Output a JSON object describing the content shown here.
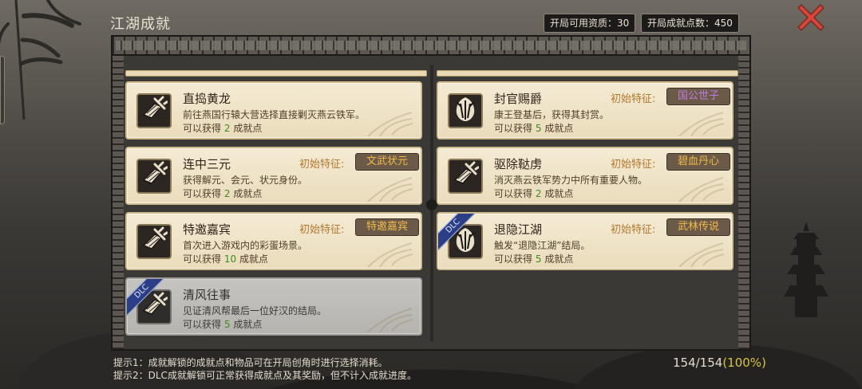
{
  "header": {
    "title": "江湖成就",
    "available_points_label": "开局可用资质：",
    "available_points_value": "30",
    "total_points_label": "开局成就点数：",
    "total_points_value": "450"
  },
  "achievements": [
    {
      "title": "直捣黄龙",
      "description": "前往燕国行辕大营选择直接剿灭燕云铁军。",
      "reward_prefix": "可以获得",
      "points": "2",
      "reward_suffix": "成就点",
      "trait_label": "",
      "trait": "",
      "trait_color": "",
      "dlc": false,
      "icon": "scroll-sword-icon"
    },
    {
      "title": "封官赐爵",
      "description": "康王登基后，获得其封赏。",
      "reward_prefix": "可以获得",
      "points": "5",
      "reward_suffix": "成就点",
      "trait_label": "初始特征:",
      "trait": "国公世子",
      "trait_color": "#c07be0",
      "dlc": false,
      "icon": "crest-icon"
    },
    {
      "title": "连中三元",
      "description": "获得解元、会元、状元身份。",
      "reward_prefix": "可以获得",
      "points": "2",
      "reward_suffix": "成就点",
      "trait_label": "初始特征:",
      "trait": "文武状元",
      "trait_color": "#f0b94b",
      "dlc": false,
      "icon": "scroll-sword-icon"
    },
    {
      "title": "驱除鞑虏",
      "description": "消灭燕云铁军势力中所有重要人物。",
      "reward_prefix": "可以获得",
      "points": "2",
      "reward_suffix": "成就点",
      "trait_label": "初始特征:",
      "trait": "碧血丹心",
      "trait_color": "#f0b94b",
      "dlc": false,
      "icon": "scroll-sword-icon"
    },
    {
      "title": "特邀嘉宾",
      "description": "首次进入游戏内的彩蛋场景。",
      "reward_prefix": "可以获得",
      "points": "10",
      "reward_suffix": "成就点",
      "trait_label": "初始特征:",
      "trait": "特邀嘉宾",
      "trait_color": "#f0b94b",
      "dlc": false,
      "icon": "scroll-sword-icon"
    },
    {
      "title": "退隐江湖",
      "description": "触发“退隐江湖”结局。",
      "reward_prefix": "可以获得",
      "points": "5",
      "reward_suffix": "成就点",
      "trait_label": "初始特征:",
      "trait": "武林传说",
      "trait_color": "#f0b94b",
      "dlc": true,
      "dlc_label": "DLC",
      "icon": "crest-icon"
    },
    {
      "title": "清风往事",
      "description": "见证清风帮最后一位好汉的结局。",
      "reward_prefix": "可以获得",
      "points": "5",
      "reward_suffix": "成就点",
      "trait_label": "",
      "trait": "",
      "trait_color": "",
      "dlc": true,
      "dlc_label": "DLC",
      "icon": "scroll-sword-icon"
    }
  ],
  "hints": [
    "提示1：成就解锁的成就点和物品可在开局创角时进行选择消耗。",
    "提示2：DLC成就解锁可正常获得成就点及其奖励，但不计入成就进度。"
  ],
  "progress": {
    "count": "154/154",
    "percent": "(100%)",
    "fraction": 1.0
  },
  "colors": {
    "points_green": "#3f8a22",
    "trait_label": "#b2772e",
    "dlc_blue": "#2c3f86",
    "close_red": "#d8473a"
  }
}
